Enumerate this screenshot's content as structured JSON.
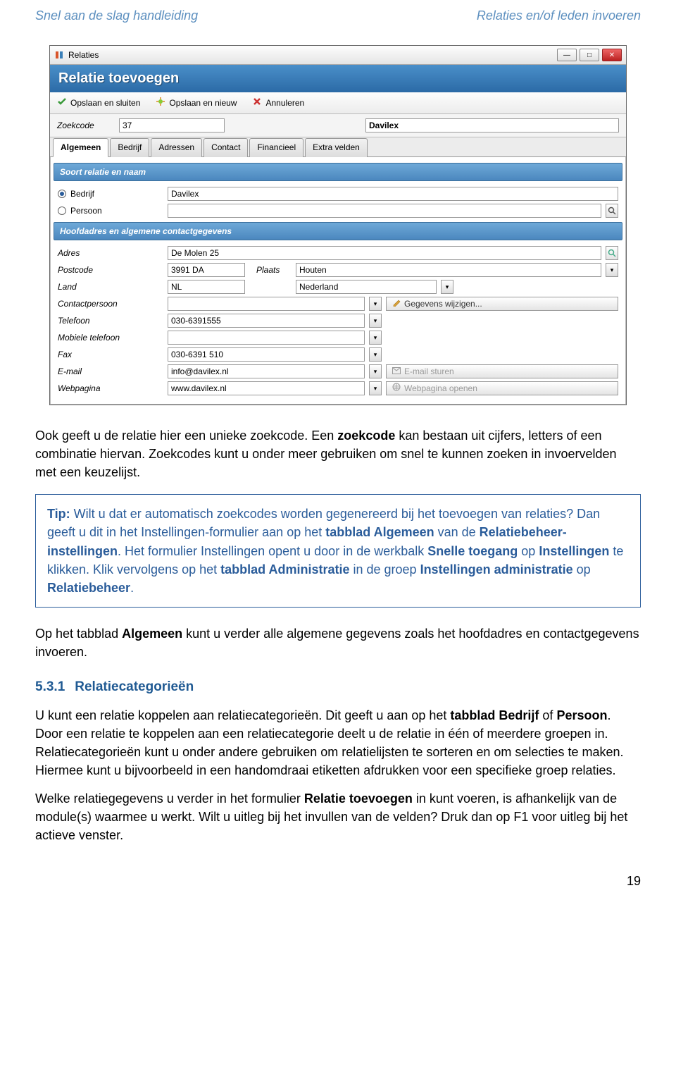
{
  "doc": {
    "header_left": "Snel aan de slag handleiding",
    "header_right": "Relaties en/of leden invoeren",
    "page_num": "19"
  },
  "window": {
    "title": "Relaties",
    "banner": "Relatie toevoegen",
    "toolbar": {
      "save_close": "Opslaan en sluiten",
      "save_new": "Opslaan en nieuw",
      "cancel": "Annuleren"
    },
    "zoek": {
      "label": "Zoekcode",
      "code": "37",
      "name": "Davilex"
    },
    "tabs": [
      "Algemeen",
      "Bedrijf",
      "Adressen",
      "Contact",
      "Financieel",
      "Extra velden"
    ],
    "section1": "Soort relatie en naam",
    "rel_type": {
      "bedrijf": "Bedrijf",
      "persoon": "Persoon",
      "bedrijf_val": "Davilex"
    },
    "section2": "Hoofdadres en algemene contactgegevens",
    "fields": {
      "adres_lbl": "Adres",
      "adres_val": "De Molen 25",
      "postcode_lbl": "Postcode",
      "postcode_val": "3991 DA",
      "plaats_lbl": "Plaats",
      "plaats_val": "Houten",
      "land_lbl": "Land",
      "land_code": "NL",
      "land_name": "Nederland",
      "contact_lbl": "Contactpersoon",
      "gegevens_btn": "Gegevens wijzigen...",
      "tel_lbl": "Telefoon",
      "tel_val": "030-6391555",
      "mob_lbl": "Mobiele telefoon",
      "fax_lbl": "Fax",
      "fax_val": "030-6391 510",
      "email_lbl": "E-mail",
      "email_val": "info@davilex.nl",
      "email_btn": "E-mail sturen",
      "web_lbl": "Webpagina",
      "web_val": "www.davilex.nl",
      "web_btn": "Webpagina openen"
    }
  },
  "body": {
    "p1a": "Ook geeft u de relatie hier een unieke zoekcode. Een ",
    "p1b": "zoekcode",
    "p1c": " kan bestaan uit cijfers, letters of een combinatie hiervan. Zoekcodes kunt u onder meer gebruiken om snel te kunnen zoeken in invoervelden met een keuzelijst.",
    "tip_head": "Tip:",
    "tip_1": " Wilt u dat er automatisch zoekcodes worden gegenereerd bij het toevoegen van relaties? Dan geeft u dit in het Instellingen-formulier aan op het ",
    "tip_kw1": "tabblad Algemeen",
    "tip_2": " van de ",
    "tip_kw2": "Relatiebeheer-instellingen",
    "tip_3": ". Het formulier Instellingen opent u door in de werkbalk ",
    "tip_kw3": "Snelle toegang",
    "tip_4": " op ",
    "tip_kw4": "Instellingen",
    "tip_5": " te klikken. Klik vervolgens op het ",
    "tip_kw5": "tabblad Administratie",
    "tip_6": " in de groep ",
    "tip_kw6": "Instellingen administratie",
    "tip_7": " op ",
    "tip_kw7": "Relatiebeheer",
    "tip_8": ".",
    "p2a": "Op het tabblad ",
    "p2b": "Algemeen",
    "p2c": " kunt u verder alle algemene gegevens zoals het hoofdadres en contactgegevens invoeren.",
    "sec_num": "5.3.1",
    "sec_title": "Relatiecategorieën",
    "p3a": "U kunt een relatie koppelen aan relatiecategorieën. Dit geeft u aan op het ",
    "p3b": "tabblad Bedrijf",
    "p3c": " of ",
    "p3d": "Persoon",
    "p3e": ". Door een relatie te koppelen aan een relatiecategorie deelt u de relatie in één of meerdere groepen in. Relatiecategorieën kunt u onder andere gebruiken om relatielijsten te sorteren en om selecties te maken. Hiermee kunt u bijvoorbeeld in een handomdraai etiketten afdrukken voor een specifieke groep relaties.",
    "p4a": "Welke relatiegegevens u verder in het formulier ",
    "p4b": "Relatie toevoegen",
    "p4c": " in kunt voeren, is afhankelijk van de module(s) waarmee u werkt. Wilt u uitleg bij het invullen van de velden? Druk dan op F1 voor uitleg bij het actieve venster."
  }
}
